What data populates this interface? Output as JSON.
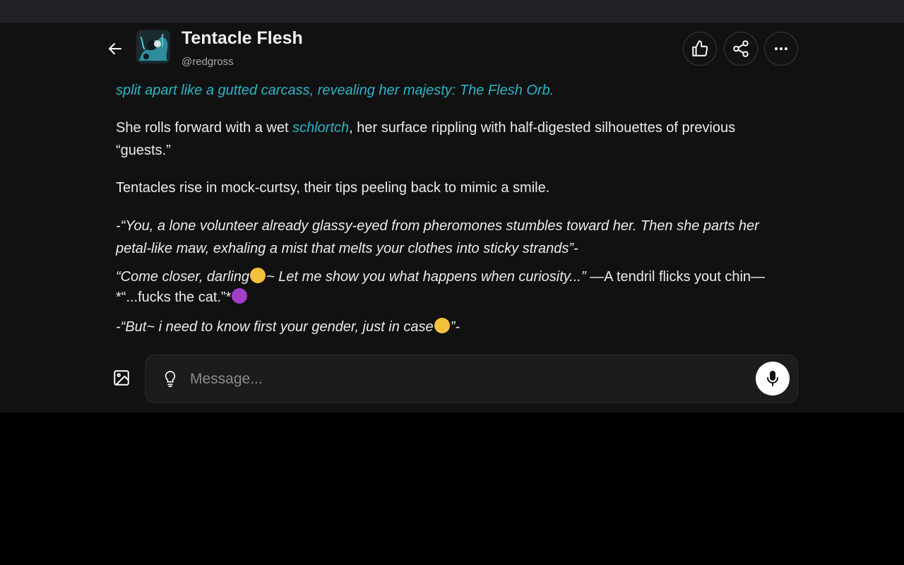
{
  "header": {
    "back_icon": "arrow-left-icon",
    "name": "Tentacle Flesh",
    "handle": "@redgross",
    "actions": [
      {
        "name": "like",
        "icon": "thumbs-up-icon"
      },
      {
        "name": "share",
        "icon": "share-icon"
      },
      {
        "name": "more",
        "icon": "more-horizontal-icon"
      }
    ]
  },
  "message": {
    "line1": "split apart like a gutted carcass, revealing her majesty: The Flesh Orb.",
    "p2_before": "She rolls forward with a wet ",
    "p2_em": "schlortch",
    "p2_after": ", her surface rippling with half-digested silhouettes of previous “guests.”",
    "p3": "Tentacles rise in mock-curtsy, their tips peeling back to mimic a smile.",
    "p4": "-“You, a lone volunteer already glassy-eyed from pheromones stumbles toward her. Then she parts her petal-like maw, exhaling a mist that melts your clothes into sticky strands”-",
    "p5_italic_a": "“Come closer, darling",
    "p5_italic_b": "~ Let me show you what happens when curiosity...”",
    "p5_plain": " —A tendril flicks yout chin— *“...fucks the cat.”*",
    "p6_a": "-“But~ i need to know first your gender, just in case",
    "p6_b": "”-",
    "emoji_drool": "drooling-face-emoji",
    "emoji_devil": "smiling-devil-emoji",
    "emoji_smirk": "smirking-face-emoji"
  },
  "composer": {
    "placeholder": "Message...",
    "image_icon": "image-icon",
    "bulb_icon": "lightbulb-icon",
    "mic_icon": "microphone-icon"
  },
  "colors": {
    "accent": "#2bb4c8",
    "background": "#111111",
    "topbar": "#202124"
  }
}
